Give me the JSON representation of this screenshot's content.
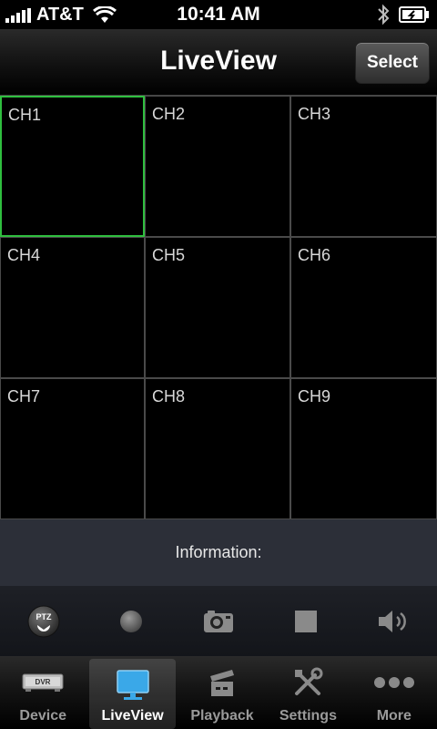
{
  "status": {
    "carrier": "AT&T",
    "time": "10:41 AM"
  },
  "navbar": {
    "title": "LiveView",
    "select_label": "Select"
  },
  "channels": [
    "CH1",
    "CH2",
    "CH3",
    "CH4",
    "CH5",
    "CH6",
    "CH7",
    "CH8",
    "CH9"
  ],
  "selected_channel": "CH1",
  "info": {
    "label": "Information:"
  },
  "toolbar": {
    "ptz_label": "PTZ",
    "items": [
      "ptz-icon",
      "record-icon",
      "camera-icon",
      "stop-icon",
      "speaker-icon"
    ]
  },
  "tabs": [
    {
      "label": "Device",
      "icon": "dvr-icon"
    },
    {
      "label": "LiveView",
      "icon": "monitor-icon",
      "active": true
    },
    {
      "label": "Playback",
      "icon": "clapperboard-icon"
    },
    {
      "label": "Settings",
      "icon": "tools-icon"
    },
    {
      "label": "More",
      "icon": "more-icon"
    }
  ],
  "dvr_badge": "DVR",
  "colors": {
    "selected_border": "#2fbf3f",
    "active_tab_icon": "#3aa8e8"
  }
}
